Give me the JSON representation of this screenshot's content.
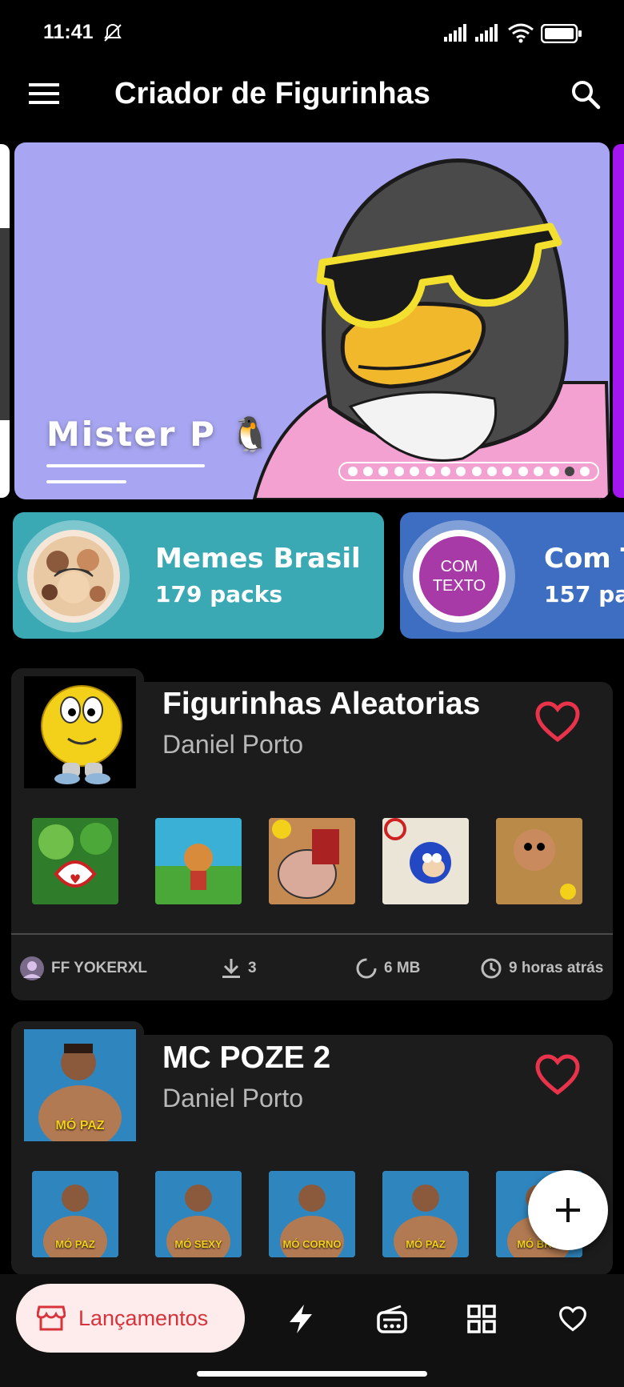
{
  "status_bar": {
    "time": "11:41"
  },
  "app_bar": {
    "title": "Criador de Figurinhas"
  },
  "banner": {
    "title": "Mister P 🐧",
    "page_count": 16,
    "active_page": 14
  },
  "categories": [
    {
      "name": "Memes Brasil",
      "count": "179 packs",
      "color": "#3aa9b4"
    },
    {
      "name": "Com T",
      "count": "157 pac",
      "badge": "COM\nTEXTO",
      "badge_line1": "COM",
      "badge_line2": "TEXTO",
      "color": "#3e6ec2"
    }
  ],
  "packs": [
    {
      "title": "Figurinhas Aleatorias",
      "author": "Daniel Porto",
      "favorite": true,
      "uploader": "FF YOKERXL",
      "downloads": "3",
      "size": "6 MB",
      "time": "9 horas atrás",
      "stickers": [
        "sticker-1",
        "sticker-2",
        "sticker-3",
        "sticker-4",
        "sticker-5"
      ]
    },
    {
      "title": "MC POZE 2",
      "author": "Daniel Porto",
      "favorite": true,
      "cover_caption": "MÓ PAZ",
      "sticker_captions": [
        "MÓ PAZ",
        "MÓ SEXY",
        "MÓ CORNO",
        "MÓ PAZ",
        "MÓ BRIS"
      ]
    }
  ],
  "bottom_nav": {
    "active_label": "Lançamentos",
    "items": [
      "store-icon",
      "bolt-icon",
      "radio-icon",
      "grid-icon",
      "heart-icon"
    ]
  },
  "colors": {
    "accent": "#e8334a",
    "background": "#000000",
    "card": "#1c1c1c"
  }
}
